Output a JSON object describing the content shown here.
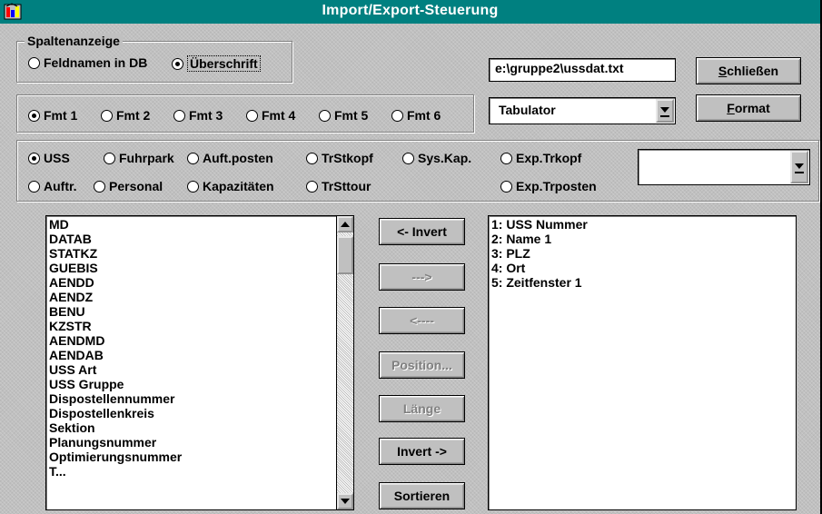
{
  "window": {
    "title": "Import/Export-Steuerung"
  },
  "spaltenanzeige": {
    "label": "Spaltenanzeige",
    "options": [
      "Feldnamen in DB",
      "Überschrift"
    ],
    "selected": "Überschrift"
  },
  "file_path": "e:\\gruppe2\\ussdat.txt",
  "buttons": {
    "close": {
      "label_prefix": "",
      "accel": "S",
      "label_rest": "chließen"
    },
    "format": {
      "accel": "F",
      "label_rest": "ormat"
    },
    "invert_left": "<- Invert",
    "move_right": "--->",
    "move_left": "<----",
    "position": "Position...",
    "laenge": "Länge",
    "invert_right": "Invert ->",
    "sortieren": "Sortieren"
  },
  "formats": {
    "options": [
      "Fmt 1",
      "Fmt 2",
      "Fmt 3",
      "Fmt 4",
      "Fmt 5",
      "Fmt 6"
    ],
    "selected": "Fmt 1"
  },
  "separator": {
    "value": "Tabulator"
  },
  "tables": {
    "row1": [
      "USS",
      "Fuhrpark",
      "Auft.posten",
      "TrStkopf",
      "Sys.Kap.",
      "Exp.Trkopf"
    ],
    "row2": [
      "Auftr.",
      "Personal",
      "Kapazitäten",
      "TrSttour",
      "Exp.Trposten"
    ],
    "selected": "USS",
    "combo_value": ""
  },
  "available_fields": [
    "MD",
    "DATAB",
    "STATKZ",
    "GUEBIS",
    "AENDD",
    "AENDZ",
    "BENU",
    "KZSTR",
    "AENDMD",
    "AENDAB",
    "USS Art",
    "USS Gruppe",
    "Dispostellennummer",
    "Dispostellenkreis",
    "Sektion",
    "Planungsnummer",
    "Optimierungsnummer",
    "T..."
  ],
  "selected_fields": [
    "1: USS Nummer",
    "2: Name 1",
    "3: PLZ",
    "4: Ort",
    "5: Zeitfenster 1"
  ],
  "colors": {
    "titlebar": "#008080",
    "face": "#c0c0c0"
  }
}
